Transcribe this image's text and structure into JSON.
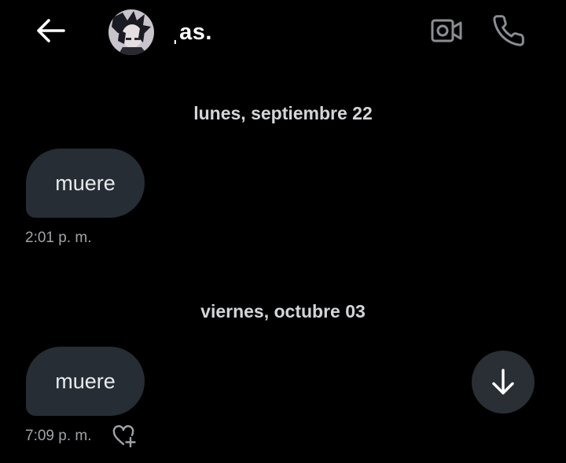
{
  "header": {
    "contact_name": "ˌas.",
    "icons": {
      "back": "back-arrow-icon",
      "video": "video-camera-icon",
      "call": "phone-icon"
    }
  },
  "messages": [
    {
      "date_separator": "lunes, septiembre 22",
      "text": "muere",
      "time": "2:01 p. m."
    },
    {
      "date_separator": "viernes, octubre 03",
      "text": "muere",
      "time": "7:09 p. m."
    }
  ],
  "colors": {
    "background": "#000000",
    "bubble": "#262d34",
    "fab": "#2a2f35",
    "text_primary": "#ffffff",
    "text_secondary": "#a0a4a9"
  }
}
